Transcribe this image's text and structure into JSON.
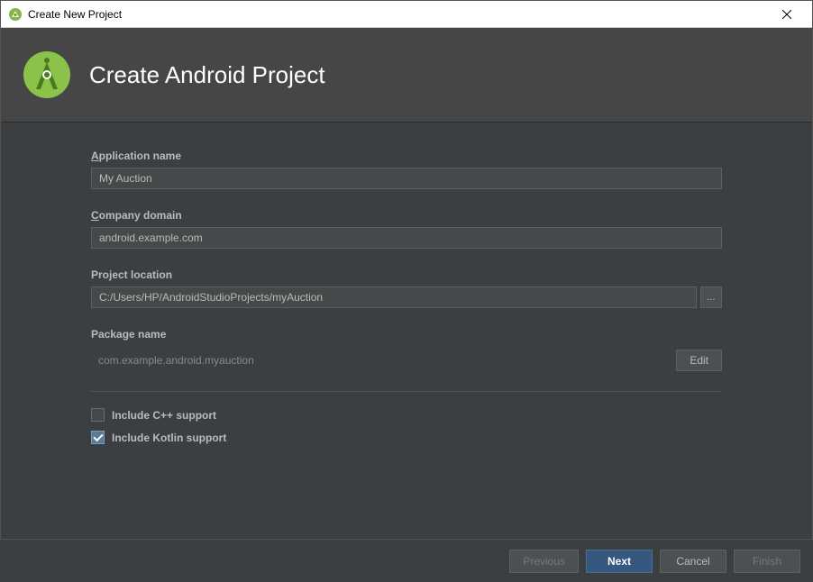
{
  "window": {
    "title": "Create New Project"
  },
  "header": {
    "title": "Create Android Project"
  },
  "fields": {
    "app_name_label": "Application name",
    "app_name_value": "My Auction",
    "company_domain_label": "Company domain",
    "company_domain_value": "android.example.com",
    "project_location_label": "Project location",
    "project_location_value": "C:/Users/HP/AndroidStudioProjects/myAuction",
    "package_name_label": "Package name",
    "package_name_value": "com.example.android.myauction",
    "edit_label": "Edit"
  },
  "checkboxes": {
    "cpp_label": "Include C++ support",
    "cpp_checked": false,
    "kotlin_label": "Include Kotlin support",
    "kotlin_checked": true
  },
  "footer": {
    "previous": "Previous",
    "next": "Next",
    "cancel": "Cancel",
    "finish": "Finish"
  }
}
